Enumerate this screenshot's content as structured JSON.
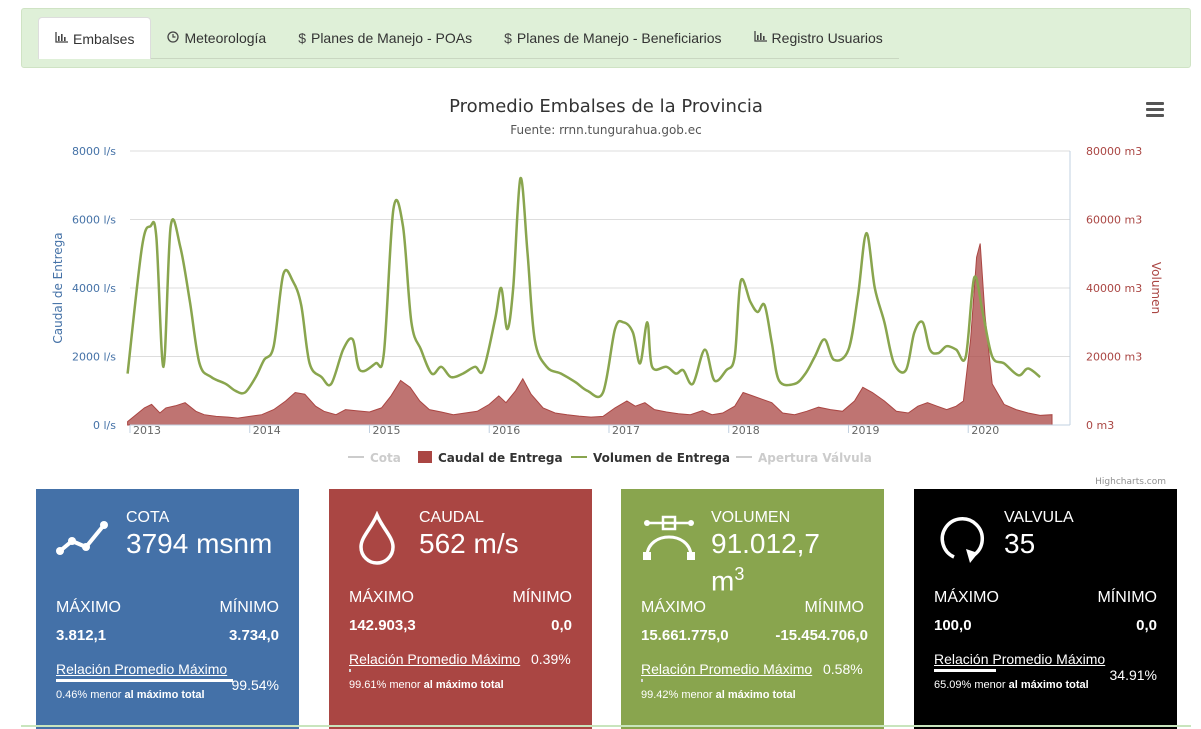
{
  "tabs": [
    {
      "label": "Embalses",
      "icon": "bar-chart-icon",
      "active": true
    },
    {
      "label": "Meteorología",
      "icon": "clock-icon",
      "active": false
    },
    {
      "label": "Planes de Manejo - POAs",
      "icon": "dollar-icon",
      "active": false
    },
    {
      "label": "Planes de Manejo - Beneficiarios",
      "icon": "dollar-icon",
      "active": false
    },
    {
      "label": "Registro Usuarios",
      "icon": "bar-chart-icon",
      "active": false
    }
  ],
  "chart": {
    "title": "Promedio Embalses de la Provincia",
    "subtitle": "Fuente: rrnn.tungurahua.gob.ec",
    "credits": "Highcharts.com"
  },
  "chart_data": {
    "type": "line",
    "title": "Promedio Embalses de la Provincia",
    "subtitle": "Fuente: rrnn.tungurahua.gob.ec",
    "ylabel_left": "Caudal de Entrega",
    "ylabel_right": "Volumen",
    "y_left_ticks": [
      "0 l/s",
      "2000 l/s",
      "4000 l/s",
      "6000 l/s",
      "8000 l/s"
    ],
    "y_right_ticks": [
      "0 m3",
      "20000 m3",
      "40000 m3",
      "60000 m3",
      "80000 m3"
    ],
    "ylim_left": [
      0,
      8000
    ],
    "ylim_right": [
      0,
      80000
    ],
    "x_ticks": [
      "2013",
      "2014",
      "2015",
      "2016",
      "2017",
      "2018",
      "2019",
      "2020"
    ],
    "xlim": [
      2013.0,
      2020.85
    ],
    "grid": true,
    "legend_position": "bottom",
    "legend": [
      {
        "name": "Cota",
        "color": "#cccccc",
        "shape": "line",
        "enabled": false
      },
      {
        "name": "Caudal de Entrega",
        "color": "#aa4643",
        "shape": "square",
        "enabled": true
      },
      {
        "name": "Volumen de Entrega",
        "color": "#89a54e",
        "shape": "line",
        "enabled": true
      },
      {
        "name": "Apertura Válvula",
        "color": "#cccccc",
        "shape": "line",
        "enabled": false
      }
    ],
    "series": [
      {
        "name": "Volumen de Entrega",
        "axis": "right",
        "color": "#89a54e",
        "type": "line",
        "points": [
          [
            2012.98,
            15000
          ],
          [
            2013.1,
            52000
          ],
          [
            2013.17,
            58000
          ],
          [
            2013.22,
            55000
          ],
          [
            2013.28,
            17000
          ],
          [
            2013.34,
            58000
          ],
          [
            2013.42,
            52000
          ],
          [
            2013.5,
            36000
          ],
          [
            2013.58,
            18000
          ],
          [
            2013.68,
            14000
          ],
          [
            2013.8,
            12000
          ],
          [
            2013.88,
            10000
          ],
          [
            2013.96,
            9500
          ],
          [
            2014.05,
            14000
          ],
          [
            2014.12,
            19000
          ],
          [
            2014.2,
            23000
          ],
          [
            2014.28,
            44000
          ],
          [
            2014.36,
            42000
          ],
          [
            2014.43,
            35000
          ],
          [
            2014.5,
            18000
          ],
          [
            2014.6,
            14000
          ],
          [
            2014.68,
            12000
          ],
          [
            2014.78,
            22000
          ],
          [
            2014.86,
            25000
          ],
          [
            2014.92,
            16000
          ],
          [
            2015.05,
            18000
          ],
          [
            2015.12,
            21000
          ],
          [
            2015.2,
            63000
          ],
          [
            2015.28,
            58000
          ],
          [
            2015.35,
            30000
          ],
          [
            2015.43,
            22000
          ],
          [
            2015.52,
            15000
          ],
          [
            2015.6,
            17000
          ],
          [
            2015.68,
            14000
          ],
          [
            2015.78,
            15000
          ],
          [
            2015.88,
            17000
          ],
          [
            2015.95,
            16000
          ],
          [
            2016.05,
            31000
          ],
          [
            2016.1,
            40000
          ],
          [
            2016.15,
            28000
          ],
          [
            2016.2,
            40000
          ],
          [
            2016.26,
            72000
          ],
          [
            2016.32,
            50000
          ],
          [
            2016.38,
            25000
          ],
          [
            2016.48,
            17000
          ],
          [
            2016.6,
            15000
          ],
          [
            2016.72,
            12500
          ],
          [
            2016.82,
            10000
          ],
          [
            2016.95,
            9500
          ],
          [
            2017.05,
            28000
          ],
          [
            2017.12,
            30000
          ],
          [
            2017.2,
            27000
          ],
          [
            2017.26,
            18000
          ],
          [
            2017.32,
            30000
          ],
          [
            2017.36,
            17000
          ],
          [
            2017.48,
            17000
          ],
          [
            2017.56,
            15000
          ],
          [
            2017.62,
            16000
          ],
          [
            2017.7,
            12000
          ],
          [
            2017.8,
            22000
          ],
          [
            2017.88,
            13000
          ],
          [
            2017.98,
            16000
          ],
          [
            2018.05,
            20000
          ],
          [
            2018.1,
            42000
          ],
          [
            2018.18,
            36000
          ],
          [
            2018.24,
            33000
          ],
          [
            2018.3,
            35000
          ],
          [
            2018.36,
            24000
          ],
          [
            2018.42,
            13000
          ],
          [
            2018.55,
            12000
          ],
          [
            2018.64,
            15000
          ],
          [
            2018.72,
            20000
          ],
          [
            2018.8,
            25000
          ],
          [
            2018.88,
            19000
          ],
          [
            2019.0,
            22000
          ],
          [
            2019.08,
            38000
          ],
          [
            2019.15,
            56000
          ],
          [
            2019.22,
            40000
          ],
          [
            2019.3,
            30000
          ],
          [
            2019.38,
            18000
          ],
          [
            2019.48,
            16000
          ],
          [
            2019.55,
            27000
          ],
          [
            2019.62,
            30000
          ],
          [
            2019.68,
            22000
          ],
          [
            2019.75,
            21000
          ],
          [
            2019.82,
            23000
          ],
          [
            2019.9,
            22000
          ],
          [
            2019.98,
            20000
          ],
          [
            2020.05,
            43000
          ],
          [
            2020.12,
            33000
          ],
          [
            2020.2,
            20000
          ],
          [
            2020.3,
            18000
          ],
          [
            2020.42,
            14500
          ],
          [
            2020.5,
            16500
          ],
          [
            2020.6,
            14000
          ]
        ]
      },
      {
        "name": "Caudal de Entrega",
        "axis": "left",
        "color": "#aa4643",
        "type": "area",
        "points": [
          [
            2012.98,
            100
          ],
          [
            2013.05,
            300
          ],
          [
            2013.12,
            500
          ],
          [
            2013.18,
            600
          ],
          [
            2013.25,
            350
          ],
          [
            2013.3,
            500
          ],
          [
            2013.38,
            560
          ],
          [
            2013.46,
            650
          ],
          [
            2013.55,
            400
          ],
          [
            2013.62,
            300
          ],
          [
            2013.72,
            250
          ],
          [
            2013.82,
            230
          ],
          [
            2013.9,
            200
          ],
          [
            2014.0,
            250
          ],
          [
            2014.1,
            300
          ],
          [
            2014.2,
            450
          ],
          [
            2014.3,
            700
          ],
          [
            2014.38,
            950
          ],
          [
            2014.46,
            900
          ],
          [
            2014.55,
            550
          ],
          [
            2014.62,
            400
          ],
          [
            2014.72,
            300
          ],
          [
            2014.8,
            450
          ],
          [
            2014.88,
            420
          ],
          [
            2015.0,
            380
          ],
          [
            2015.1,
            500
          ],
          [
            2015.18,
            850
          ],
          [
            2015.26,
            1300
          ],
          [
            2015.34,
            1100
          ],
          [
            2015.42,
            700
          ],
          [
            2015.5,
            450
          ],
          [
            2015.6,
            380
          ],
          [
            2015.7,
            300
          ],
          [
            2015.8,
            350
          ],
          [
            2015.9,
            400
          ],
          [
            2016.0,
            600
          ],
          [
            2016.08,
            850
          ],
          [
            2016.14,
            650
          ],
          [
            2016.22,
            1000
          ],
          [
            2016.28,
            1350
          ],
          [
            2016.35,
            900
          ],
          [
            2016.45,
            500
          ],
          [
            2016.55,
            350
          ],
          [
            2016.65,
            300
          ],
          [
            2016.75,
            260
          ],
          [
            2016.85,
            230
          ],
          [
            2016.95,
            250
          ],
          [
            2017.05,
            500
          ],
          [
            2017.15,
            700
          ],
          [
            2017.22,
            550
          ],
          [
            2017.3,
            650
          ],
          [
            2017.38,
            450
          ],
          [
            2017.48,
            380
          ],
          [
            2017.58,
            330
          ],
          [
            2017.68,
            300
          ],
          [
            2017.78,
            420
          ],
          [
            2017.86,
            300
          ],
          [
            2017.95,
            350
          ],
          [
            2018.05,
            550
          ],
          [
            2018.12,
            950
          ],
          [
            2018.2,
            850
          ],
          [
            2018.28,
            750
          ],
          [
            2018.36,
            650
          ],
          [
            2018.45,
            350
          ],
          [
            2018.55,
            300
          ],
          [
            2018.65,
            400
          ],
          [
            2018.75,
            520
          ],
          [
            2018.85,
            450
          ],
          [
            2018.95,
            400
          ],
          [
            2019.05,
            700
          ],
          [
            2019.12,
            1100
          ],
          [
            2019.2,
            950
          ],
          [
            2019.3,
            700
          ],
          [
            2019.4,
            400
          ],
          [
            2019.5,
            350
          ],
          [
            2019.58,
            550
          ],
          [
            2019.66,
            650
          ],
          [
            2019.74,
            550
          ],
          [
            2019.82,
            450
          ],
          [
            2019.9,
            550
          ],
          [
            2019.96,
            700
          ],
          [
            2020.02,
            2500
          ],
          [
            2020.07,
            4900
          ],
          [
            2020.1,
            5300
          ],
          [
            2020.14,
            3200
          ],
          [
            2020.2,
            1200
          ],
          [
            2020.3,
            600
          ],
          [
            2020.4,
            450
          ],
          [
            2020.5,
            350
          ],
          [
            2020.6,
            280
          ],
          [
            2020.7,
            300
          ]
        ]
      }
    ]
  },
  "cards": [
    {
      "label": "COTA",
      "value": "3794 msnm",
      "icon": "line-chart-icon",
      "color": "#4471a8",
      "max_label": "MÁXIMO",
      "min_label": "MÍNIMO",
      "max": "3.812,1",
      "min": "3.734,0",
      "relation": "Relación Promedio Máximo",
      "percent": "99.54%",
      "relation_fraction": 0.9954,
      "note_prefix": "0.46% menor ",
      "note_bold": "al máximo total"
    },
    {
      "label": "CAUDAL",
      "value": "562 m/s",
      "icon": "drop-icon",
      "color": "#aa4643",
      "max_label": "MÁXIMO",
      "min_label": "MÍNIMO",
      "max": "142.903,3",
      "min": "0,0",
      "relation": "Relación Promedio Máximo",
      "percent": "0.39%",
      "relation_fraction": 0.0039,
      "note_prefix": "99.61% menor ",
      "note_bold": "al máximo total"
    },
    {
      "label": "VOLUMEN",
      "value_main": "91.012,7",
      "value_unit": "m",
      "value_sup": "3",
      "icon": "bezier-curve-icon",
      "color": "#89a54e",
      "max_label": "MÁXIMO",
      "min_label": "MÍNIMO",
      "max": "15.661.775,0",
      "min": "-15.454.706,0",
      "relation": "Relación Promedio Máximo",
      "percent": "0.58%",
      "relation_fraction": 0.0058,
      "note_prefix": "99.42% menor ",
      "note_bold": "al máximo total"
    },
    {
      "label": "VALVULA",
      "value": "35",
      "icon": "circular-arrow-icon",
      "color": "#000000",
      "max_label": "MÁXIMO",
      "min_label": "MÍNIMO",
      "max": "100,0",
      "min": "0,0",
      "relation": "Relación Promedio Máximo",
      "percent": "34.91%",
      "relation_fraction": 0.3491,
      "note_prefix": "65.09% menor ",
      "note_bold": "al máximo total"
    }
  ]
}
